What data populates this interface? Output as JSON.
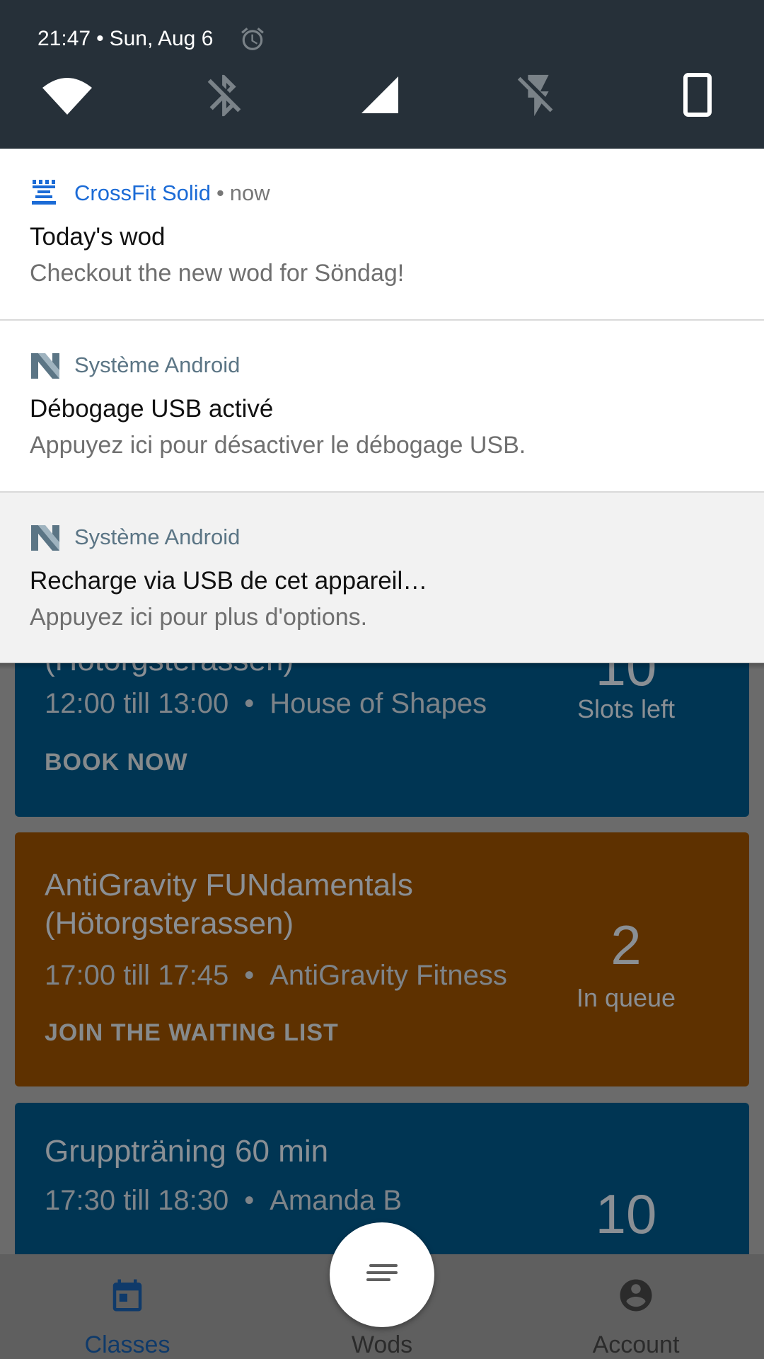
{
  "status_bar": {
    "time": "21:47",
    "separator": "•",
    "date": "Sun, Aug 6",
    "icons": [
      "alarm-icon",
      "wifi-icon",
      "bluetooth-off-icon",
      "cellular-signal-icon",
      "flashlight-off-icon",
      "portrait-rotation-icon"
    ],
    "colors": {
      "background": "#263039",
      "icon_on": "#ffffff",
      "icon_off": "#7a8288"
    }
  },
  "notifications": [
    {
      "app_icon": "crossfit-solid-icon",
      "app_name": "CrossFit Solid",
      "separator": "•",
      "time": "now",
      "title": "Today's wod",
      "text": "Checkout the new wod for Söndag!"
    },
    {
      "app_icon": "android-system-icon",
      "app_name": "Système Android",
      "title": "Débogage USB activé",
      "text": "Appuyez ici pour désactiver le débogage USB."
    },
    {
      "app_icon": "android-system-icon",
      "app_name": "Système Android",
      "title": "Recharge via USB de cet appareil…",
      "text": "Appuyez ici pour plus d'options."
    }
  ],
  "classes": [
    {
      "title": "(Hötorgsterassen)",
      "time": "12:00 till 13:00",
      "separator": "•",
      "location": "House of Shapes",
      "count": "10",
      "count_label": "Slots left",
      "action": "BOOK NOW",
      "color": "#003553"
    },
    {
      "title": "AntiGravity FUNdamentals (Hötorgsterassen)",
      "time": "17:00 till 17:45",
      "separator": "•",
      "location": "AntiGravity Fitness",
      "count": "2",
      "count_label": "In queue",
      "action": "JOIN THE WAITING LIST",
      "color": "#5e3100"
    },
    {
      "title": "Gruppträning 60 min",
      "time": "17:30 till 18:30",
      "separator": "•",
      "location": "Amanda B",
      "count": "10",
      "color": "#003553"
    }
  ],
  "bottom_nav": {
    "items": [
      {
        "label": "Classes",
        "icon": "calendar-icon",
        "active": true
      },
      {
        "label": "Wods",
        "icon": "notes-icon",
        "active": false
      },
      {
        "label": "Account",
        "icon": "account-circle-icon",
        "active": false
      }
    ],
    "active_color": "#0f3a6a",
    "inactive_color": "#2b2b2b"
  },
  "fab": {
    "icon": "notes-icon"
  }
}
